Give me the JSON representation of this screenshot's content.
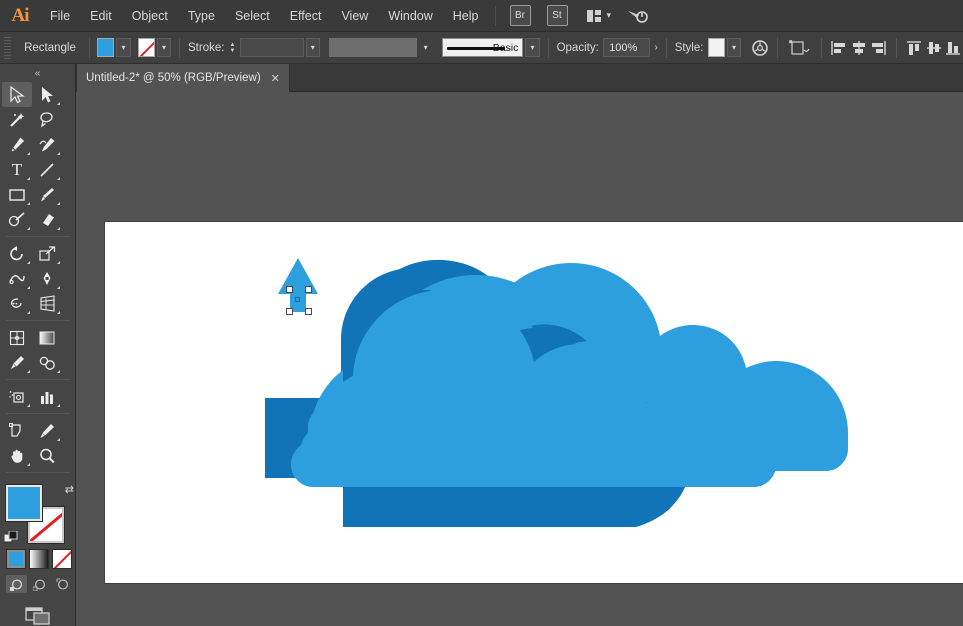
{
  "app": {
    "name": "Adobe Illustrator",
    "logo_text": "Ai"
  },
  "menubar": {
    "items": [
      "File",
      "Edit",
      "Object",
      "Type",
      "Select",
      "Effect",
      "View",
      "Window",
      "Help"
    ],
    "bridge_label": "Br",
    "stock_label": "St",
    "arrange_icon": "arrange-documents-icon",
    "workspace_icon": "workspace-switcher-icon",
    "chevron": "▾"
  },
  "controlbar": {
    "selection_label": "Rectangle",
    "fill_color": "#2e9fde",
    "fill_dropdown_icon": "chevron-down-icon",
    "stroke_swatch_state": "none",
    "stroke_dropdown_icon": "chevron-down-icon",
    "stroke_label": "Stroke:",
    "stroke_weight_value": "",
    "stroke_weight_dropdown": "chevron-down-icon",
    "variable_width_value": "",
    "brush_name": "Basic",
    "brush_dropdown_icon": "chevron-down-icon",
    "opacity_label": "Opacity:",
    "opacity_value": "100%",
    "opacity_arrow": "›",
    "style_label": "Style:",
    "style_swatch": "#f2f2f2",
    "style_dropdown_icon": "chevron-down-icon",
    "recolor_icon": "recolor-artwork-icon",
    "transform_icon": "transform-icon",
    "align_icons": [
      "align-left-icon",
      "align-horizontal-center-icon",
      "align-right-icon",
      "align-top-icon",
      "align-vertical-center-icon",
      "align-bottom-icon"
    ]
  },
  "tab": {
    "title": "Untitled-2* @ 50% (RGB/Preview)",
    "close_glyph": "✕"
  },
  "toolbar": {
    "collapse_glyph": "«",
    "tools": [
      {
        "name": "selection-tool",
        "glyph": "➤",
        "selected": true,
        "hidden_more": false
      },
      {
        "name": "direct-selection-tool",
        "glyph": "➤",
        "selected": false,
        "hidden_more": true
      },
      {
        "name": "magic-wand-tool",
        "glyph": "✦",
        "selected": false,
        "hidden_more": false
      },
      {
        "name": "lasso-tool",
        "glyph": "℘",
        "selected": false,
        "hidden_more": false
      },
      {
        "name": "pen-tool",
        "glyph": "✒",
        "selected": false,
        "hidden_more": true
      },
      {
        "name": "curvature-tool",
        "glyph": "✒",
        "selected": false,
        "hidden_more": true
      },
      {
        "name": "type-tool",
        "glyph": "T",
        "selected": false,
        "hidden_more": true
      },
      {
        "name": "line-segment-tool",
        "glyph": "╱",
        "selected": false,
        "hidden_more": true
      },
      {
        "name": "rectangle-tool",
        "glyph": "▭",
        "selected": false,
        "hidden_more": true
      },
      {
        "name": "paintbrush-tool",
        "glyph": "✐",
        "selected": false,
        "hidden_more": true
      },
      {
        "name": "shaper-tool",
        "glyph": "◌",
        "selected": false,
        "hidden_more": true
      },
      {
        "name": "eraser-tool",
        "glyph": "◇",
        "selected": false,
        "hidden_more": true
      },
      {
        "name": "rotate-tool",
        "glyph": "↺",
        "selected": false,
        "hidden_more": true
      },
      {
        "name": "scale-tool",
        "glyph": "⤢",
        "selected": false,
        "hidden_more": true
      },
      {
        "name": "width-tool",
        "glyph": "∿",
        "selected": false,
        "hidden_more": true
      },
      {
        "name": "free-transform-tool",
        "glyph": "✣",
        "selected": false,
        "hidden_more": true
      },
      {
        "name": "shape-builder-tool",
        "glyph": "⊛",
        "selected": false,
        "hidden_more": true
      },
      {
        "name": "perspective-grid-tool",
        "glyph": "◰",
        "selected": false,
        "hidden_more": true
      },
      {
        "name": "mesh-tool",
        "glyph": "⌗",
        "selected": false,
        "hidden_more": false
      },
      {
        "name": "gradient-tool",
        "glyph": "▤",
        "selected": false,
        "hidden_more": false
      },
      {
        "name": "eyedropper-tool",
        "glyph": "✑",
        "selected": false,
        "hidden_more": true
      },
      {
        "name": "blend-tool",
        "glyph": "❁",
        "selected": false,
        "hidden_more": true
      },
      {
        "name": "symbol-sprayer-tool",
        "glyph": "⁂",
        "selected": false,
        "hidden_more": true
      },
      {
        "name": "column-graph-tool",
        "glyph": "█",
        "selected": false,
        "hidden_more": true
      },
      {
        "name": "artboard-tool",
        "glyph": "⬚",
        "selected": false,
        "hidden_more": false
      },
      {
        "name": "slice-tool",
        "glyph": "✂",
        "selected": false,
        "hidden_more": true
      },
      {
        "name": "hand-tool",
        "glyph": "✋",
        "selected": false,
        "hidden_more": true
      },
      {
        "name": "zoom-tool",
        "glyph": "⚲",
        "selected": false,
        "hidden_more": false
      }
    ],
    "fill_color": "#2e9fde",
    "stroke_state": "none",
    "swap_glyph": "⇄",
    "color_modes": [
      {
        "name": "color-mode-button",
        "active": true
      },
      {
        "name": "gradient-mode-button",
        "active": false
      },
      {
        "name": "none-mode-button",
        "active": false
      }
    ],
    "draw_modes": [
      {
        "name": "draw-normal-button",
        "active": true
      },
      {
        "name": "draw-behind-button",
        "active": false
      },
      {
        "name": "draw-inside-button",
        "active": false
      }
    ],
    "screen_mode": "change-screen-mode-button"
  },
  "artwork": {
    "cloud_front_color": "#2e9fde",
    "cloud_shadow_color": "#1173b8",
    "arrow_color": "#2e9fde",
    "selection_handle_color": "#ffffff",
    "selected_object": "rectangle",
    "zoom_percent": "50%"
  }
}
